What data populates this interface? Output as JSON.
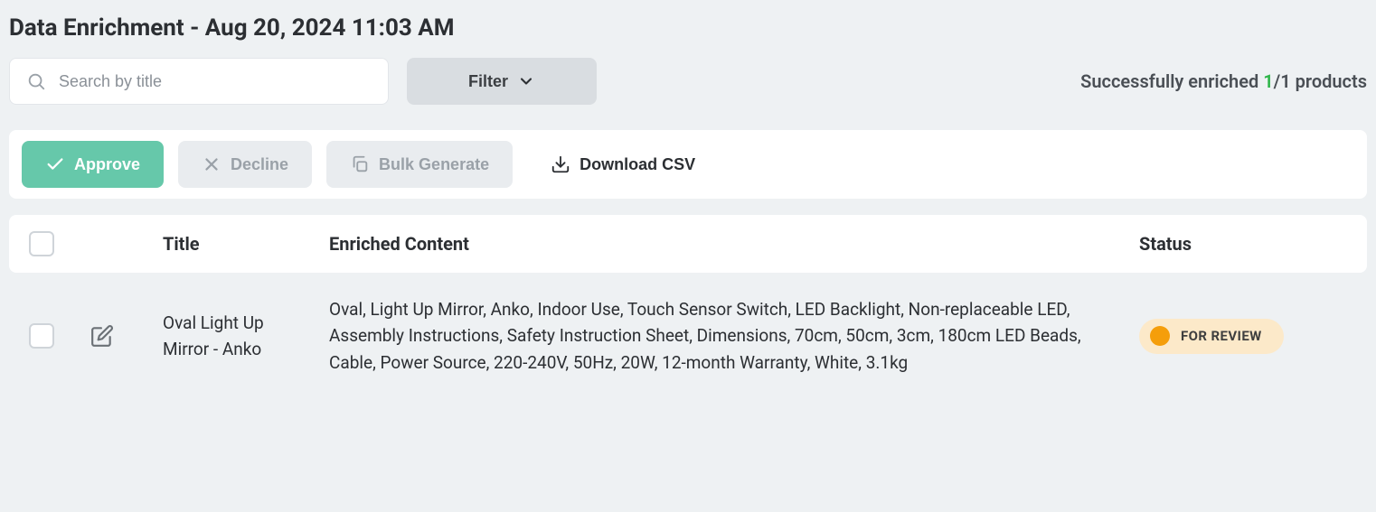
{
  "page": {
    "title": "Data Enrichment - Aug 20, 2024 11:03 AM"
  },
  "search": {
    "placeholder": "Search by title"
  },
  "filter": {
    "label": "Filter"
  },
  "status_summary": {
    "prefix": "Successfully enriched ",
    "count": "1",
    "total": "/1 products"
  },
  "actions": {
    "approve": "Approve",
    "decline": "Decline",
    "bulk_generate": "Bulk Generate",
    "download_csv": "Download CSV"
  },
  "table": {
    "headers": {
      "title": "Title",
      "content": "Enriched Content",
      "status": "Status"
    },
    "rows": [
      {
        "title": "Oval Light Up Mirror - Anko",
        "content": "Oval, Light Up Mirror, Anko, Indoor Use, Touch Sensor Switch, LED Backlight, Non-replaceable LED, Assembly Instructions, Safety Instruction Sheet, Dimensions, 70cm, 50cm, 3cm, 180cm LED Beads, Cable, Power Source, 220-240V, 50Hz, 20W, 12-month Warranty, White, 3.1kg",
        "status": "FOR REVIEW"
      }
    ]
  }
}
